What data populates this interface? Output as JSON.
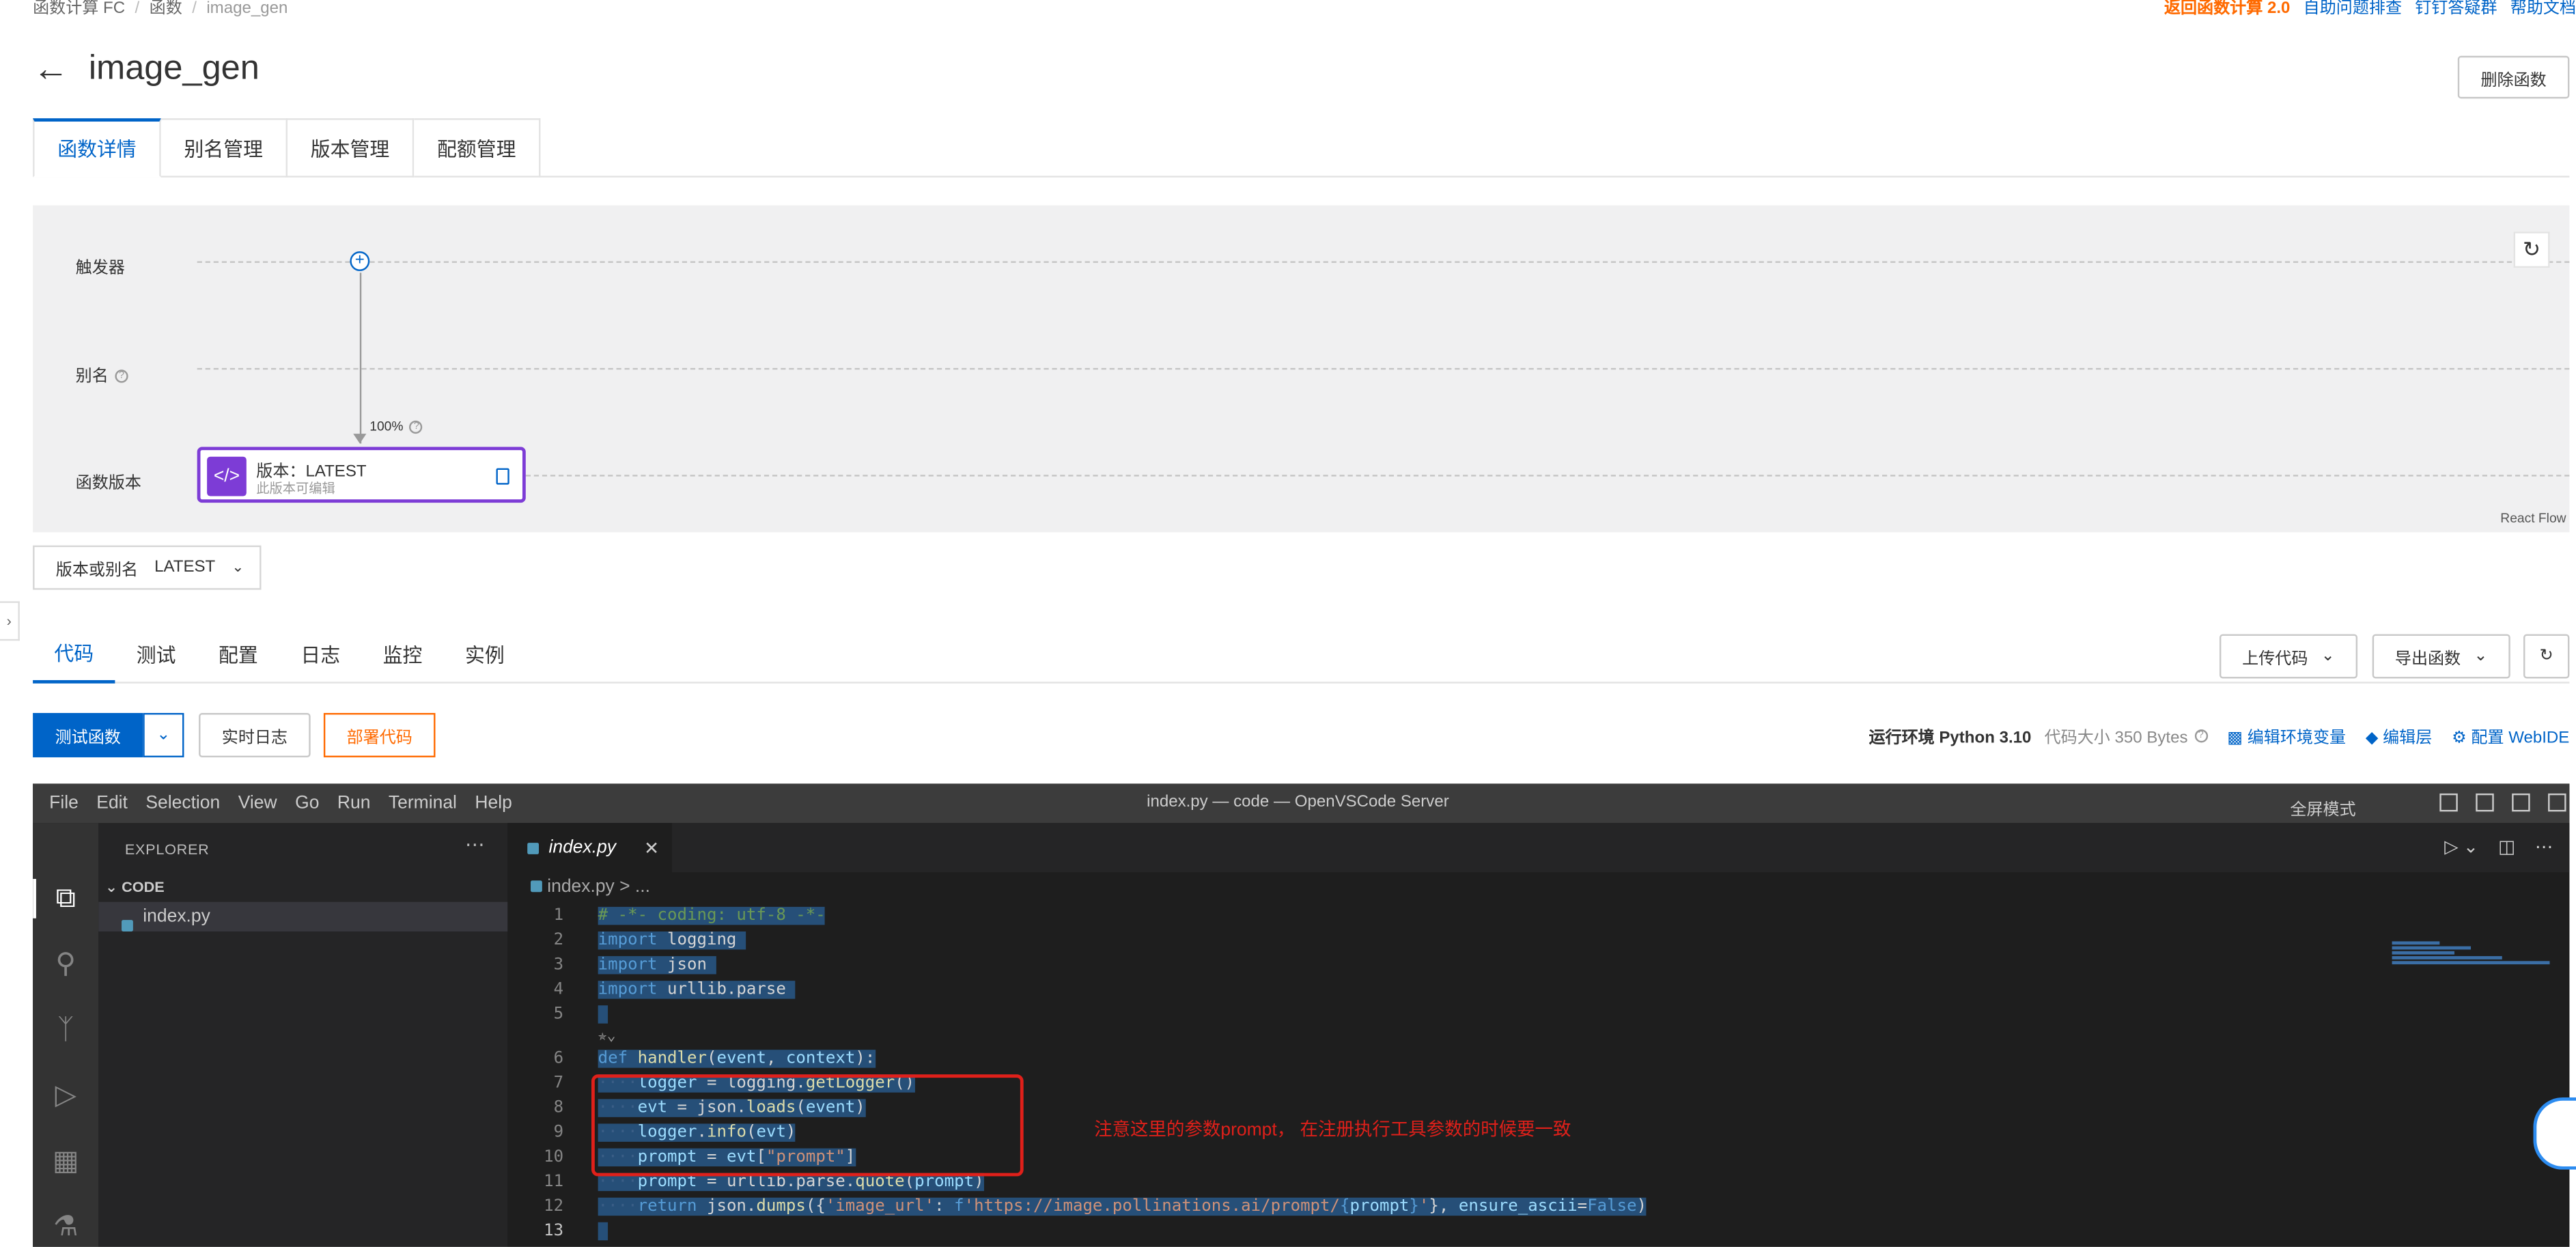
{
  "breadcrumb": [
    "函数计算 FC",
    "函数",
    "image_gen"
  ],
  "top_links": {
    "back_v2": "返回函数计算 2.0",
    "self_check": "自助问题排查",
    "dingtalk": "钉钉答疑群",
    "help": "帮助文档"
  },
  "page": {
    "title": "image_gen",
    "delete_label": "删除函数"
  },
  "main_tabs": [
    "函数详情",
    "别名管理",
    "版本管理",
    "配额管理"
  ],
  "flow": {
    "trigger_label": "触发器",
    "alias_label": "别名",
    "version_label": "函数版本",
    "percent": "100%",
    "node_title": "版本：LATEST",
    "node_sub": "此版本可编辑",
    "react_flow": "React Flow"
  },
  "version_select": {
    "label": "版本或别名",
    "value": "LATEST"
  },
  "sub_tabs": [
    "代码",
    "测试",
    "配置",
    "日志",
    "监控",
    "实例"
  ],
  "toolbar": {
    "upload_code": "上传代码",
    "export_function": "导出函数",
    "test_function": "测试函数",
    "realtime_log": "实时日志",
    "deploy_code": "部署代码",
    "runtime": "运行环境 Python 3.10",
    "code_size": "代码大小 350 Bytes",
    "edit_env": "编辑环境变量",
    "edit_layer": "编辑层",
    "config_webide": "配置 WebIDE"
  },
  "ide": {
    "menu": [
      "File",
      "Edit",
      "Selection",
      "View",
      "Go",
      "Run",
      "Terminal",
      "Help"
    ],
    "window_title": "index.py — code — OpenVSCode Server",
    "fullscreen": "全屏模式",
    "explorer_title": "EXPLORER",
    "section": "CODE",
    "file": "index.py",
    "tab": "index.py",
    "breadcrumb": "index.py > ...",
    "annotation": "注意这里的参数prompt，  在注册执行工具参数的时候要一致"
  },
  "colors": {
    "primary": "#0064c8",
    "accent_orange": "#ff6a00",
    "node_purple": "#7d3cd6",
    "annotation_red": "#e0201a"
  }
}
